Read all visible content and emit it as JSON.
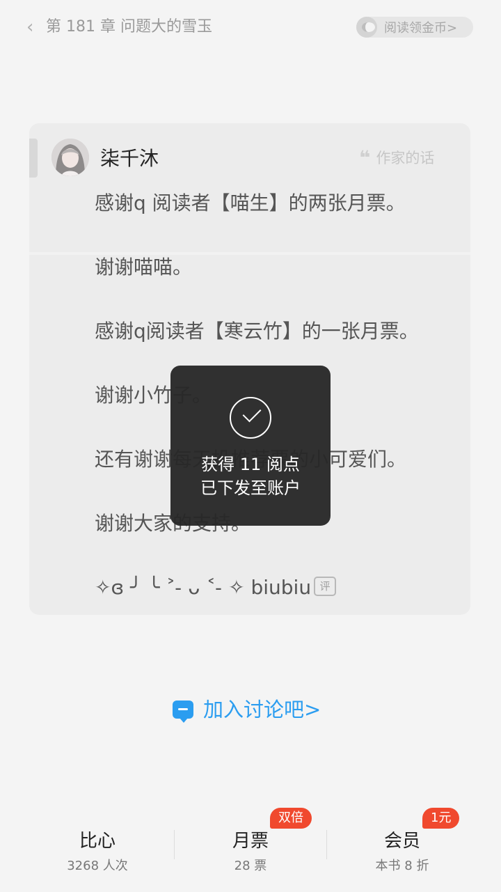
{
  "header": {
    "back_icon": "chevron-left-icon",
    "chapter_title": "第 181 章  问题大的雪玉",
    "coin_label": "阅读领金币>"
  },
  "author_note": {
    "author_name": "柒千沐",
    "badge_label": "作家的话",
    "lines": [
      "感谢q 阅读者【喵生】的两张月票。",
      "谢谢喵喵。",
      "感谢q阅读者【寒云竹】的一张月票。",
      "谢谢小竹子。",
      "还有谢谢每天投推荐票的小可爱们。",
      "谢谢大家的支持。",
      "✧ɞ ╯ ╰ ˃ ̵ ᴗ ˂ ̵ ✧ biubiu"
    ],
    "comment_icon_label": "评"
  },
  "join_discussion": "加入讨论吧>",
  "bottom_bar": {
    "items": [
      {
        "title": "比心",
        "sub": "3268 人次",
        "badge": ""
      },
      {
        "title": "月票",
        "sub": "28 票",
        "badge": "双倍"
      },
      {
        "title": "会员",
        "sub": "本书 8 折",
        "badge": "1元"
      }
    ]
  },
  "toast": {
    "line1": "获得 11 阅点",
    "line2": "已下发至账户"
  },
  "colors": {
    "accent_blue": "#2b9df0",
    "badge_red": "#f0492e"
  }
}
